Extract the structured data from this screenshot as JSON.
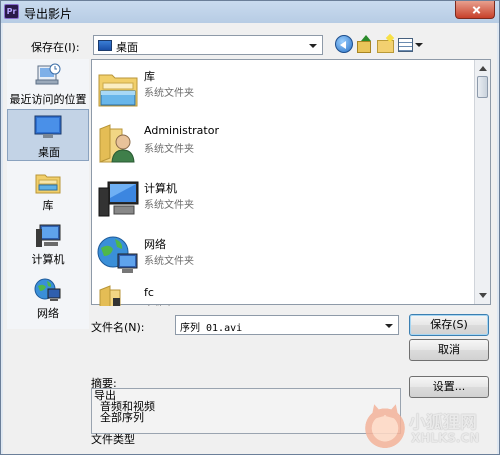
{
  "window": {
    "title": "导出影片",
    "app_icon_text": "Pr"
  },
  "toolbar": {
    "save_in_label": "保存在(I):",
    "save_in_value": "桌面"
  },
  "places": [
    {
      "label": "最近访问的位置",
      "icon": "recent-places-icon"
    },
    {
      "label": "桌面",
      "icon": "desktop-icon",
      "selected": true
    },
    {
      "label": "库",
      "icon": "library-icon"
    },
    {
      "label": "计算机",
      "icon": "computer-icon"
    },
    {
      "label": "网络",
      "icon": "network-icon"
    }
  ],
  "files": [
    {
      "name": "库",
      "type": "系统文件夹",
      "icon": "library-folder-icon"
    },
    {
      "name": "Administrator",
      "type": "系统文件夹",
      "icon": "user-folder-icon"
    },
    {
      "name": "计算机",
      "type": "系统文件夹",
      "icon": "computer-icon"
    },
    {
      "name": "网络",
      "type": "系统文件夹",
      "icon": "network-icon"
    },
    {
      "name": "fc",
      "type": "文件夹",
      "icon": "folder-icon"
    }
  ],
  "filename": {
    "label": "文件名(N):",
    "value": "序列 01.avi"
  },
  "buttons": {
    "save": "保存(S)",
    "cancel": "取消",
    "settings": "设置..."
  },
  "summary": {
    "label": "摘要:",
    "lines": [
      "导出",
      "音频和视频",
      "全部序列"
    ]
  },
  "file_type_label": "文件类型",
  "watermark": {
    "text_cn": "小狐狸网",
    "text_en": "XHLKS.CN"
  },
  "colors": {
    "title_bar": "#c9dbef",
    "selection": "#c3d3e6",
    "default_button_border": "#3c7fb1"
  }
}
